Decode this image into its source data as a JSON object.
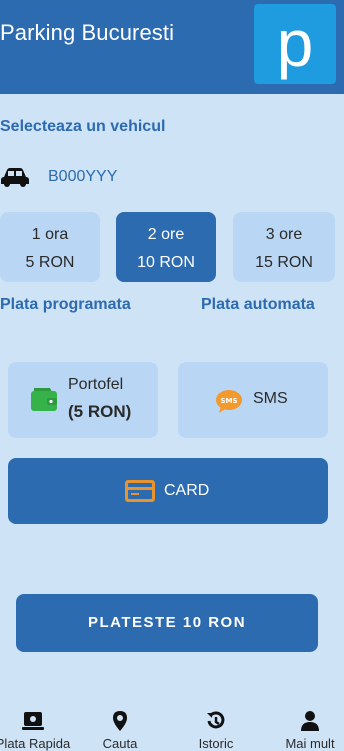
{
  "header": {
    "title": "Parking Bucuresti",
    "logo_letter": "p",
    "logo_icon": "parking-logo"
  },
  "vehicle_section": {
    "title": "Selecteaza un vehicul",
    "icon": "car-icon",
    "plate": "B000YYY"
  },
  "durations": [
    {
      "time": "1 ora",
      "price": "5 RON",
      "selected": false
    },
    {
      "time": "2 ore",
      "price": "10 RON",
      "selected": true
    },
    {
      "time": "3 ore",
      "price": "15 RON",
      "selected": false
    }
  ],
  "options": {
    "scheduled": "Plata programata",
    "automatic": "Plata automata"
  },
  "payment": {
    "wallet": {
      "title": "Portofel",
      "amount": "(5 RON)",
      "icon": "wallet-icon"
    },
    "sms": {
      "label": "SMS",
      "icon_text": "SMS",
      "icon": "sms-icon"
    },
    "card": {
      "label": "CARD",
      "icon": "credit-card-icon"
    }
  },
  "pay_button": "PLATESTE 10 RON",
  "nav": [
    {
      "label": "Plata Rapida",
      "icon": "quick-pay-icon"
    },
    {
      "label": "Cauta",
      "icon": "location-pin-icon"
    },
    {
      "label": "Istoric",
      "icon": "history-icon"
    },
    {
      "label": "Mai mult",
      "icon": "user-icon"
    }
  ],
  "colors": {
    "primary": "#2d6bb0",
    "background": "#cfe3f6",
    "tile": "#b9d7f4",
    "logo_bg": "#1f9be0",
    "wallet_green": "#35b34a",
    "sms_orange": "#f39a2e",
    "card_orange": "#e8932c"
  }
}
